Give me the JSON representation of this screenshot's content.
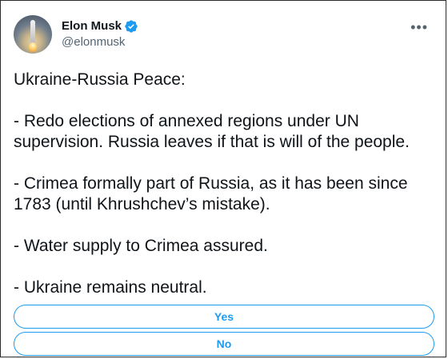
{
  "author": {
    "display_name": "Elon Musk",
    "handle": "@elonmusk",
    "verified": true
  },
  "tweet": {
    "paragraphs": [
      "Ukraine-Russia Peace:",
      "- Redo elections of annexed regions under UN supervision. Russia leaves if that is will of the people.",
      "- Crimea formally part of Russia, as it has been since 1783 (until Khrushchev’s mistake).",
      "- Water supply to Crimea assured.",
      "- Ukraine remains neutral."
    ]
  },
  "poll": {
    "options": [
      "Yes",
      "No"
    ]
  },
  "icons": {
    "more": "more-options-icon",
    "verified": "verified-badge-icon"
  },
  "colors": {
    "accent": "#1d9bf0",
    "text": "#0f1419",
    "muted": "#536471"
  }
}
